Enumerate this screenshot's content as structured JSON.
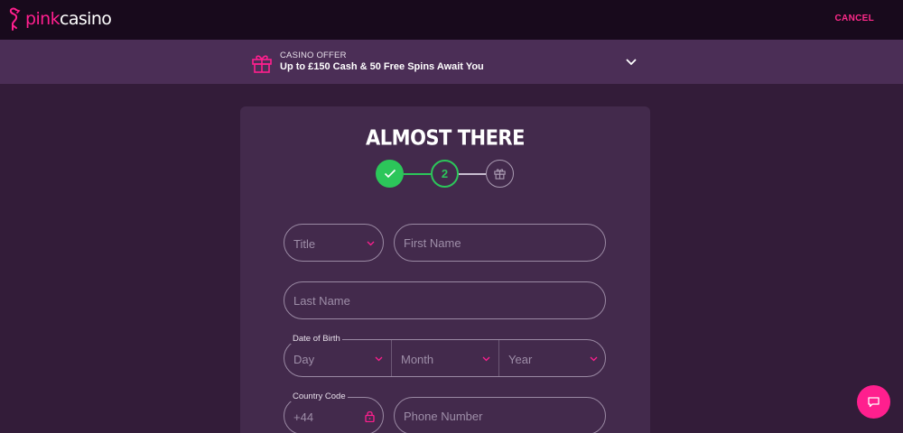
{
  "header": {
    "logo_text_pink": "pink",
    "logo_text_white": "casino",
    "cancel_label": "CANCEL"
  },
  "offer": {
    "label": "CASINO OFFER",
    "text": "Up to £150 Cash & 50 Free Spins Await You"
  },
  "form": {
    "title": "ALMOST THERE",
    "steps": [
      {
        "state": "complete",
        "icon": "check-icon"
      },
      {
        "state": "current",
        "label": "2"
      },
      {
        "state": "upcoming",
        "icon": "gift-icon"
      }
    ],
    "title_select": "Title",
    "first_name_placeholder": "First Name",
    "last_name_placeholder": "Last Name",
    "dob_label": "Date of Birth",
    "day_label": "Day",
    "month_label": "Month",
    "year_label": "Year",
    "country_code_label": "Country Code",
    "country_code_value": "+44",
    "phone_placeholder": "Phone Number"
  },
  "colors": {
    "accent": "#ff1f8e",
    "success": "#2cc65a",
    "page_bg": "#331c39",
    "card_bg": "#432a4c"
  },
  "chat": {
    "icon": "chat-icon"
  }
}
